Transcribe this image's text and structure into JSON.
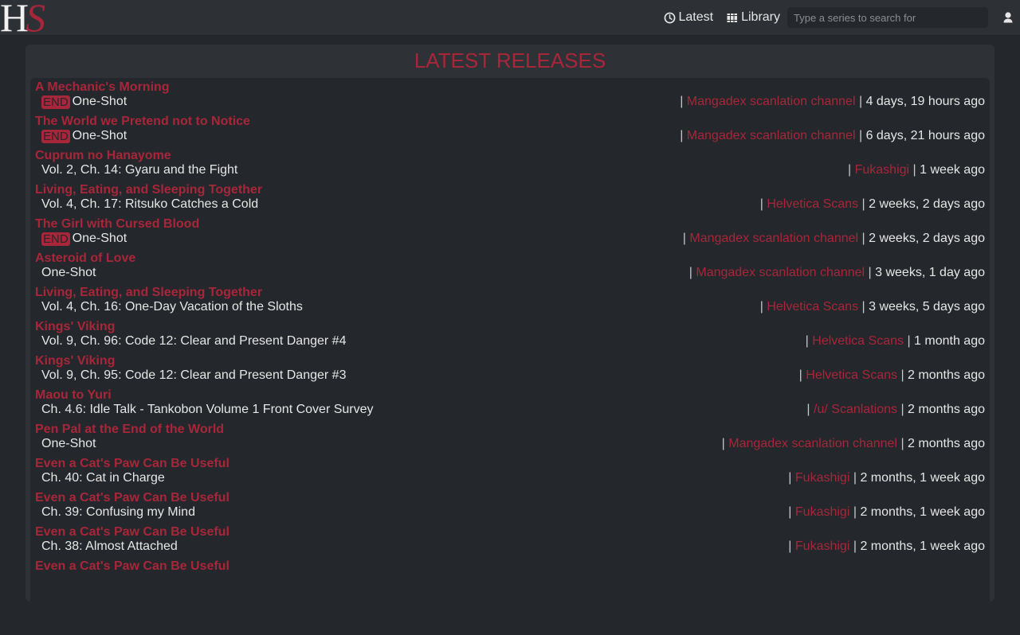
{
  "brand": {
    "logo_h": "H",
    "logo_s": "S"
  },
  "nav": {
    "latest_label": "Latest",
    "library_label": "Library",
    "search_placeholder": "Type a series to search for",
    "search_value": ""
  },
  "colors": {
    "accent": "#a8263a",
    "background": "#24272b",
    "panel": "#2e3136"
  },
  "page": {
    "title": "LATEST RELEASES"
  },
  "separator": "|",
  "releases": [
    {
      "series": "A Mechanic's Morning",
      "badge": "END",
      "chapter": "One-Shot",
      "group": "Mangadex scanlation channel",
      "time": "4 days, 19 hours ago"
    },
    {
      "series": "The World we Pretend not to Notice",
      "badge": "END",
      "chapter": "One-Shot",
      "group": "Mangadex scanlation channel",
      "time": "6 days, 21 hours ago"
    },
    {
      "series": "Cuprum no Hanayome",
      "badge": "",
      "chapter": "Vol. 2, Ch. 14: Gyaru and the Fight",
      "group": "Fukashigi",
      "time": "1 week ago"
    },
    {
      "series": "Living, Eating, and Sleeping Together",
      "badge": "",
      "chapter": "Vol. 4, Ch. 17: Ritsuko Catches a Cold",
      "group": "Helvetica Scans",
      "time": "2 weeks, 2 days ago"
    },
    {
      "series": "The Girl with Cursed Blood",
      "badge": "END",
      "chapter": "One-Shot",
      "group": "Mangadex scanlation channel",
      "time": "2 weeks, 2 days ago"
    },
    {
      "series": "Asteroid of Love",
      "badge": "",
      "chapter": "One-Shot",
      "group": "Mangadex scanlation channel",
      "time": "3 weeks, 1 day ago"
    },
    {
      "series": "Living, Eating, and Sleeping Together",
      "badge": "",
      "chapter": "Vol. 4, Ch. 16: One-Day Vacation of the Sloths",
      "group": "Helvetica Scans",
      "time": "3 weeks, 5 days ago"
    },
    {
      "series": "Kings' Viking",
      "badge": "",
      "chapter": "Vol. 9, Ch. 96: Code 12: Clear and Present Danger #4",
      "group": "Helvetica Scans",
      "time": "1 month ago"
    },
    {
      "series": "Kings' Viking",
      "badge": "",
      "chapter": "Vol. 9, Ch. 95: Code 12: Clear and Present Danger #3",
      "group": "Helvetica Scans",
      "time": "2 months ago"
    },
    {
      "series": "Maou to Yuri",
      "badge": "",
      "chapter": "Ch. 4.6: Idle Talk - Tankobon Volume 1 Front Cover Survey",
      "group": "/u/ Scanlations",
      "time": "2 months ago"
    },
    {
      "series": "Pen Pal at the End of the World",
      "badge": "",
      "chapter": "One-Shot",
      "group": "Mangadex scanlation channel",
      "time": "2 months ago"
    },
    {
      "series": "Even a Cat's Paw Can Be Useful",
      "badge": "",
      "chapter": "Ch. 40: Cat in Charge",
      "group": "Fukashigi",
      "time": "2 months, 1 week ago"
    },
    {
      "series": "Even a Cat's Paw Can Be Useful",
      "badge": "",
      "chapter": "Ch. 39: Confusing my Mind",
      "group": "Fukashigi",
      "time": "2 months, 1 week ago"
    },
    {
      "series": "Even a Cat's Paw Can Be Useful",
      "badge": "",
      "chapter": "Ch. 38: Almost Attached",
      "group": "Fukashigi",
      "time": "2 months, 1 week ago"
    },
    {
      "series": "Even a Cat's Paw Can Be Useful",
      "badge": "",
      "chapter": "",
      "group": "",
      "time": ""
    }
  ]
}
